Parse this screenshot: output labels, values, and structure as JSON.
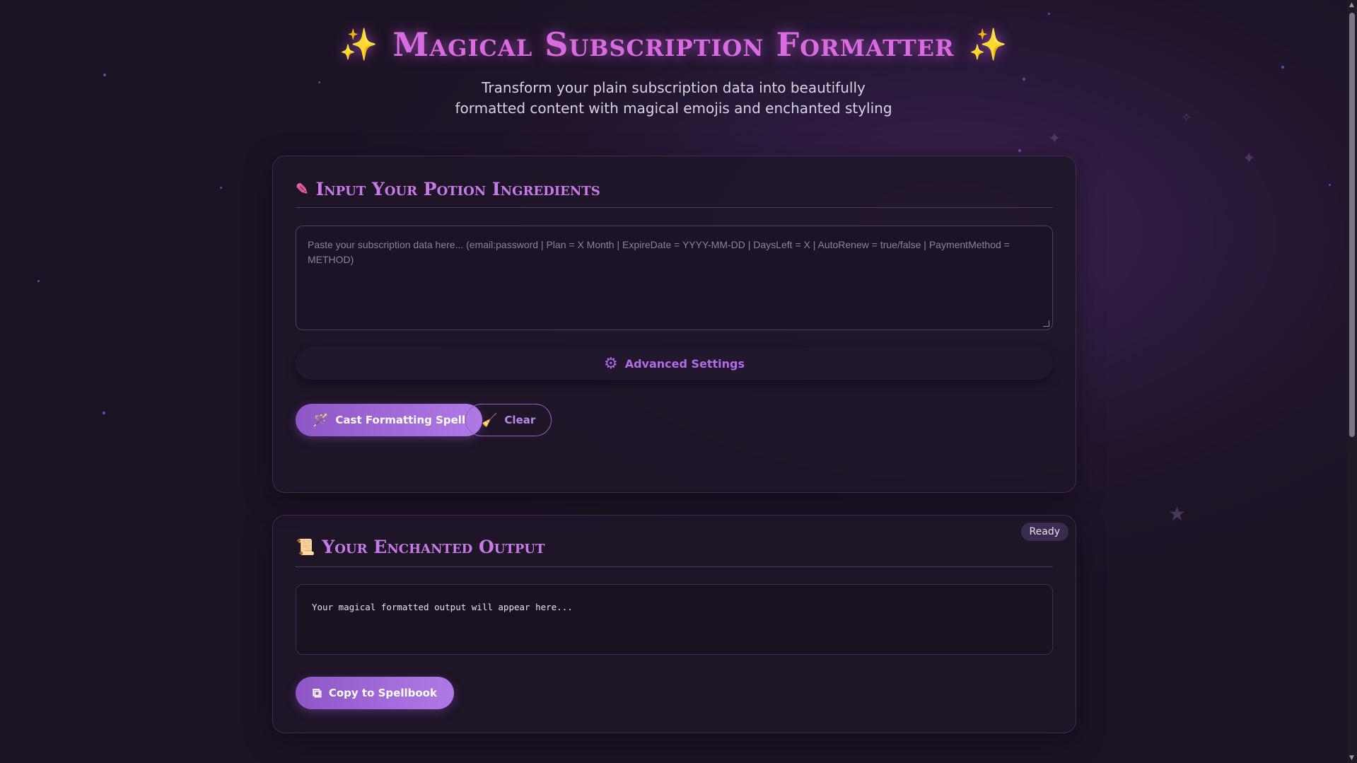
{
  "header": {
    "title": "Magical Subscription Formatter",
    "title_left_icon": "sparkles-icon",
    "title_right_icon": "sparkles-icon",
    "subtitle": "Transform your plain subscription data into beautifully formatted content with magical emojis and enchanted styling"
  },
  "input_card": {
    "title": "Input Your Potion Ingredients",
    "title_icon": "pencil-icon",
    "textarea_placeholder": "Paste your subscription data here... (email:password | Plan = X Month | ExpireDate = YYYY-MM-DD | DaysLeft = X | AutoRenew = true/false | PaymentMethod = METHOD)",
    "textarea_value": "",
    "advanced_label": "Advanced Settings",
    "advanced_icon": "gear-icon",
    "cast_button_label": "Cast Formatting Spell",
    "cast_button_icon": "magic-wand-icon",
    "clear_button_label": "Clear",
    "clear_button_icon": "broom-icon"
  },
  "output_card": {
    "title": "Your Enchanted Output",
    "title_icon": "scroll-icon",
    "status_badge": "Ready",
    "output_placeholder": "Your magical formatted output will appear here...",
    "copy_button_label": "Copy to Spellbook",
    "copy_button_icon": "copy-icon"
  },
  "colors": {
    "accent": "#c77ae8",
    "title_glow": "#d86be0",
    "pink_icon": "#ec5fa0",
    "button_gradient_start": "#8e56c6",
    "button_gradient_end": "#b07ae6",
    "background": "#1e1428"
  }
}
